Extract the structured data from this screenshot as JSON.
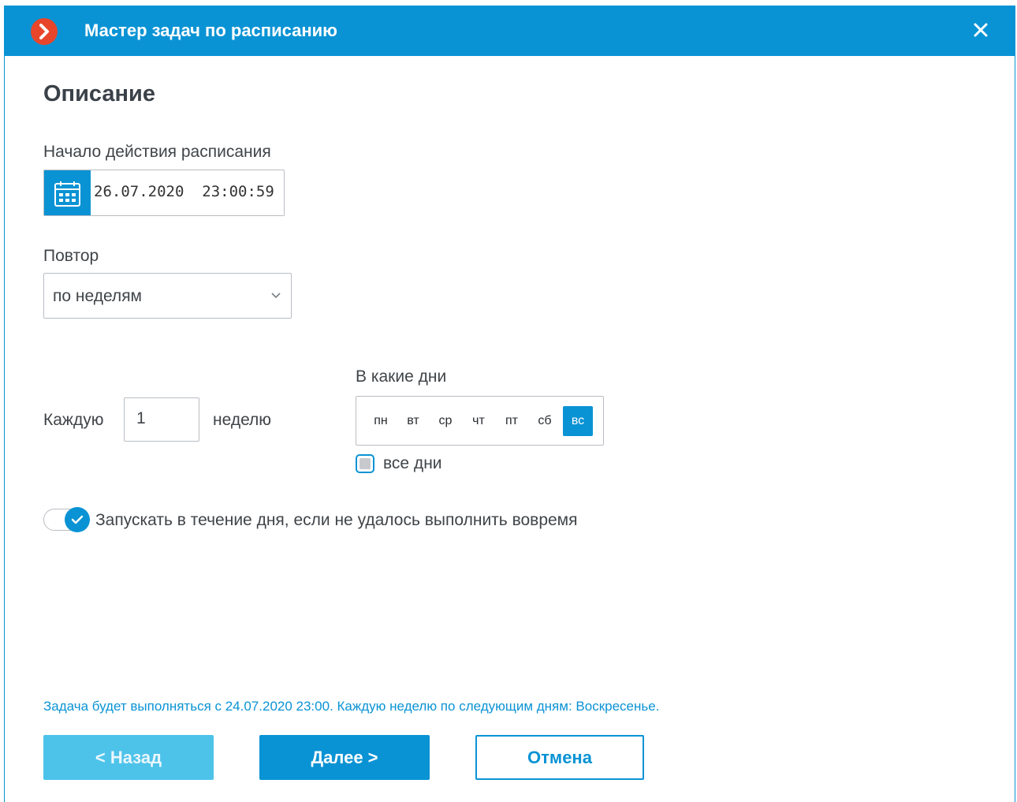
{
  "window": {
    "title": "Мастер задач по расписанию"
  },
  "section": {
    "title": "Описание"
  },
  "start": {
    "label": "Начало действия расписания",
    "value": "26.07.2020  23:00:59"
  },
  "repeat": {
    "label": "Повтор",
    "selected": "по неделям"
  },
  "every": {
    "label": "Каждую",
    "value": "1",
    "unit": "неделю"
  },
  "days": {
    "label": "В какие дни",
    "items": [
      {
        "label": "пн",
        "selected": false
      },
      {
        "label": "вт",
        "selected": false
      },
      {
        "label": "ср",
        "selected": false
      },
      {
        "label": "чт",
        "selected": false
      },
      {
        "label": "пт",
        "selected": false
      },
      {
        "label": "сб",
        "selected": false
      },
      {
        "label": "вс",
        "selected": true
      }
    ],
    "all_days_label": "все дни",
    "all_days_checked": false
  },
  "run_missed": {
    "label": "Запускать в течение дня, если не удалось выполнить вовремя",
    "enabled": true
  },
  "summary": "Задача будет выполняться с 24.07.2020 23:00. Каждую неделю по следующим дням: Воскресенье.",
  "buttons": {
    "back": "< Назад",
    "next": "Далее >",
    "cancel": "Отмена"
  },
  "colors": {
    "accent": "#0a93d4",
    "logo": "#e8462b",
    "disabled_button": "#4dc3ea"
  },
  "icons": {
    "logo": "chevron-right-logo-icon",
    "close": "close-icon",
    "calendar": "calendar-icon",
    "dropdown": "chevron-down-icon",
    "toggle_check": "check-icon"
  }
}
